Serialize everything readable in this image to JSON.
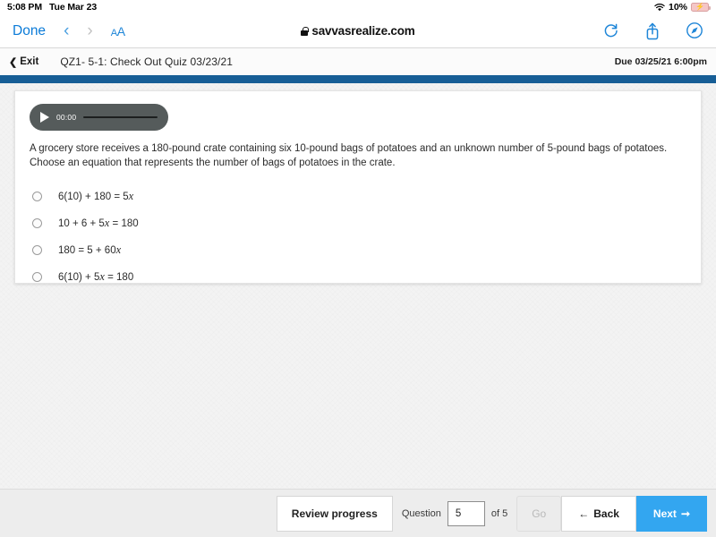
{
  "status_bar": {
    "time": "5:08 PM",
    "date": "Tue Mar 23",
    "wifi_icon": "wifi-icon",
    "battery_percent": "10%",
    "battery_icon": "battery-charging-icon"
  },
  "safari": {
    "done_label": "Done",
    "back_icon": "chevron-left-icon",
    "forward_icon": "chevron-right-icon",
    "text_size_label": "AA",
    "lock_icon": "lock-icon",
    "url": "savvasrealize.com",
    "reload_icon": "reload-icon",
    "share_icon": "share-icon",
    "compass_icon": "compass-icon"
  },
  "quiz_header": {
    "exit_icon": "chevron-left-icon",
    "exit_label": "Exit",
    "title": "QZ1- 5-1: Check Out Quiz 03/23/21",
    "due": "Due 03/25/21 6:00pm",
    "accent_color": "#175e96"
  },
  "audio": {
    "play_icon": "play-icon",
    "time": "00:00"
  },
  "question": {
    "text": "A grocery store receives a 180-pound crate containing six 10-pound bags of potatoes and an unknown number of 5-pound bags of potatoes. Choose an equation that represents the number of bags of potatoes in the crate.",
    "choices": [
      {
        "pre": "6(10) + 180 = 5",
        "var": "x",
        "post": ""
      },
      {
        "pre": "10 + 6 + 5",
        "var": "x",
        "post": " = 180"
      },
      {
        "pre": "180 = 5 + 60",
        "var": "x",
        "post": ""
      },
      {
        "pre": "6(10) + 5",
        "var": "x",
        "post": " = 180"
      }
    ]
  },
  "bottom_nav": {
    "review_label": "Review progress",
    "question_label": "Question",
    "question_value": "5",
    "of_label": "of 5",
    "go_label": "Go",
    "back_icon": "arrow-left-icon",
    "back_label": "Back",
    "next_label": "Next",
    "next_icon": "arrow-right-icon",
    "next_color": "#33a6f0"
  }
}
